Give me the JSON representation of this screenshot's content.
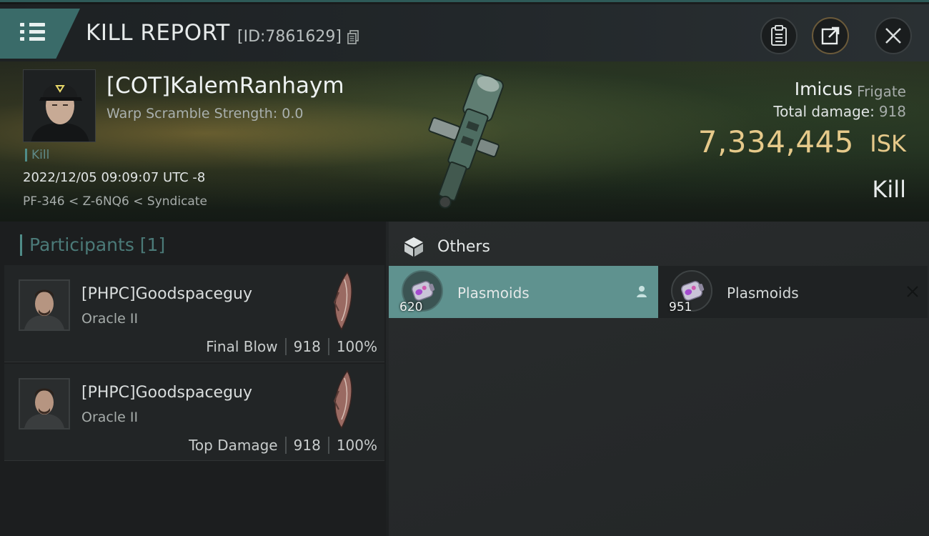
{
  "header": {
    "title": "KILL REPORT",
    "report_id": "[ID:7861629]",
    "icons": [
      "menu-icon",
      "copy-icon",
      "clipboard-icon",
      "share-icon",
      "close-icon"
    ]
  },
  "victim": {
    "name": "[COT]KalemRanhaym",
    "warp_scramble": "Warp Scramble Strength: 0.0",
    "kill_tag": "Kill",
    "datetime": "2022/12/05 09:09:07 UTC -8",
    "location": "PF-346 < Z-6NQ6 < Syndicate",
    "ship_name": "Imicus",
    "ship_class": "Frigate",
    "total_damage_label": "Total damage:",
    "total_damage_value": "918",
    "isk_value": "7,334,445",
    "isk_unit": "ISK",
    "kill_label": "Kill"
  },
  "participants": {
    "header": "Participants [1]",
    "rows": [
      {
        "name": "[PHPC]Goodspaceguy",
        "ship": "Oracle II",
        "role": "Final Blow",
        "damage": "918",
        "percent": "100%"
      },
      {
        "name": "[PHPC]Goodspaceguy",
        "ship": "Oracle II",
        "role": "Top Damage",
        "damage": "918",
        "percent": "100%"
      }
    ]
  },
  "others": {
    "header": "Others",
    "items": [
      {
        "name": "Plasmoids",
        "qty": "620",
        "selected": true
      },
      {
        "name": "Plasmoids",
        "qty": "951",
        "selected": false
      }
    ]
  },
  "colors": {
    "accent_teal": "#5f928f",
    "isk_gold": "#e6c98a",
    "menu_teal": "#3a6b69"
  }
}
